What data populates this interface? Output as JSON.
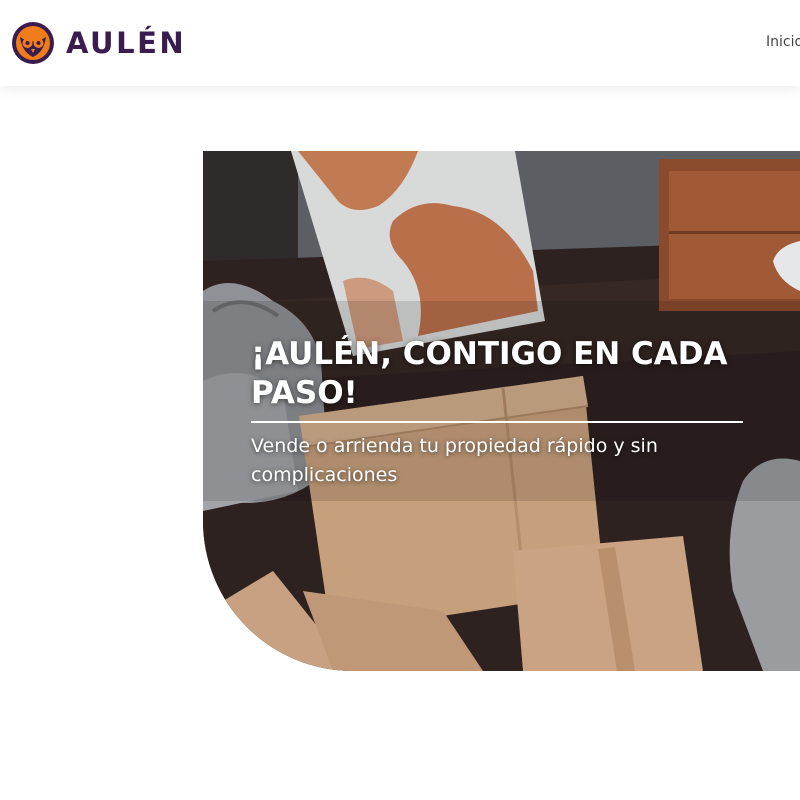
{
  "header": {
    "brand": {
      "name": "AULÉN",
      "icon": "owl-logo-icon",
      "colors": {
        "primary": "#3a1d4f",
        "accent": "#f07d1a"
      }
    },
    "nav": {
      "items": [
        {
          "label": "Inicio"
        }
      ]
    }
  },
  "hero": {
    "title": "¡AULÉN, CONTIGO EN CADA PASO!",
    "subtitle": "Vende o arrienda tu propiedad rápido y sin complicaciones",
    "image": "moving-boxes-living-room-photo"
  }
}
